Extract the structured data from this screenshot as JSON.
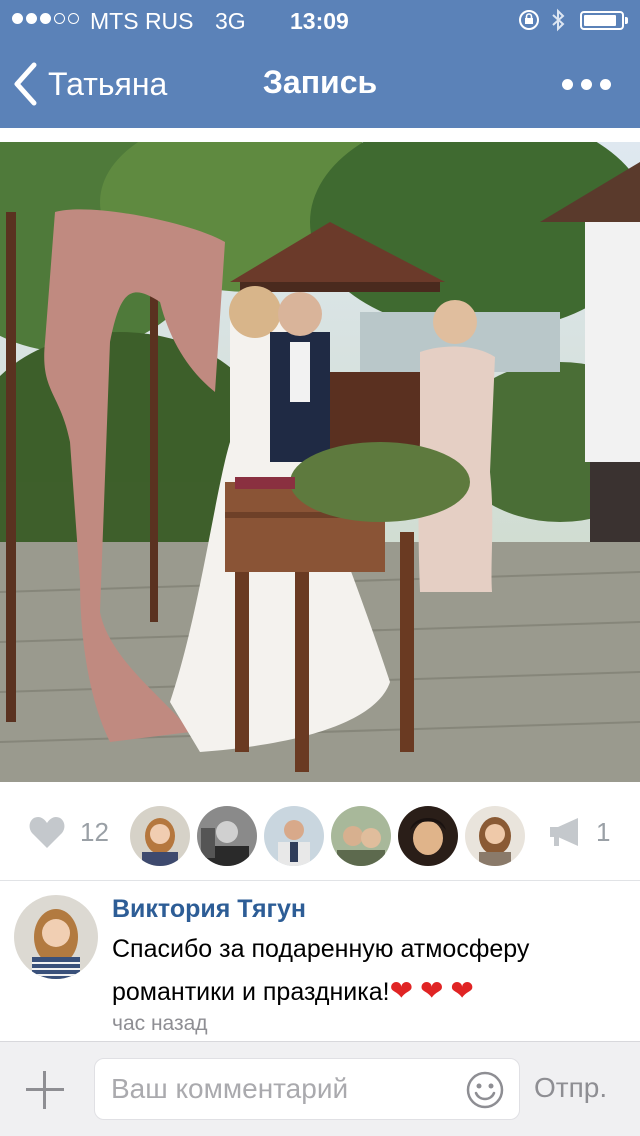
{
  "status_bar": {
    "carrier": "MTS RUS",
    "network": "3G",
    "time": "13:09",
    "battery_level": 0.9
  },
  "nav": {
    "back_label": "Татьяна",
    "title": "Запись",
    "back_icon": "chevron-left-icon",
    "more_icon": "more-horizontal-icon"
  },
  "post": {
    "photo": "wedding-ceremony-photo",
    "likes_count": "12",
    "shares_count": "1",
    "liker_avatars": [
      "avatar-1",
      "avatar-2",
      "avatar-3",
      "avatar-4",
      "avatar-5",
      "avatar-6"
    ]
  },
  "comment": {
    "author": "Виктория Тягун",
    "text": "Спасибо за подаренную атмосферу романтики и праздника!",
    "emoji": [
      "❤",
      "❤",
      "❤"
    ],
    "time": "час назад"
  },
  "composer": {
    "placeholder": "Ваш комментарий",
    "send_label": "Отпр."
  },
  "colors": {
    "header_bg": "#5b82b8",
    "author_link": "#2d5d96",
    "muted": "#8e8e93"
  }
}
